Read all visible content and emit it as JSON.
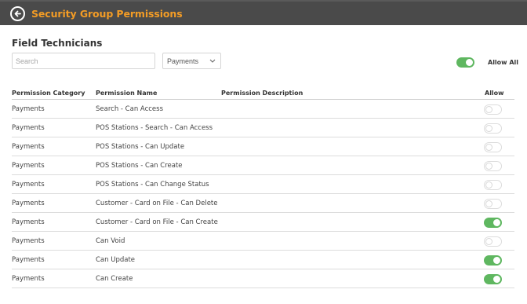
{
  "header": {
    "title": "Security Group Permissions",
    "back_icon": "back-arrow-icon"
  },
  "group": {
    "name": "Field Technicians"
  },
  "search": {
    "placeholder": "Search",
    "value": ""
  },
  "category_filter": {
    "selected": "Payments"
  },
  "allow_all": {
    "label": "Allow All",
    "on": true
  },
  "table": {
    "columns": [
      "Permission Category",
      "Permission Name",
      "Permission Description",
      "Allow"
    ],
    "rows": [
      {
        "category": "Payments",
        "name": "Search - Can Access",
        "description": "",
        "allow": false
      },
      {
        "category": "Payments",
        "name": "POS Stations - Search - Can Access",
        "description": "",
        "allow": false
      },
      {
        "category": "Payments",
        "name": "POS Stations - Can Update",
        "description": "",
        "allow": false
      },
      {
        "category": "Payments",
        "name": "POS Stations - Can Create",
        "description": "",
        "allow": false
      },
      {
        "category": "Payments",
        "name": "POS Stations - Can Change Status",
        "description": "",
        "allow": false
      },
      {
        "category": "Payments",
        "name": "Customer - Card on File - Can Delete",
        "description": "",
        "allow": false
      },
      {
        "category": "Payments",
        "name": "Customer - Card on File - Can Create",
        "description": "",
        "allow": true
      },
      {
        "category": "Payments",
        "name": "Can Void",
        "description": "",
        "allow": false
      },
      {
        "category": "Payments",
        "name": "Can Update",
        "description": "",
        "allow": true
      },
      {
        "category": "Payments",
        "name": "Can Create",
        "description": "",
        "allow": true
      }
    ]
  },
  "colors": {
    "header_bg": "#4a4a4a",
    "title_orange": "#f39c25",
    "toggle_on": "#5fb760"
  }
}
